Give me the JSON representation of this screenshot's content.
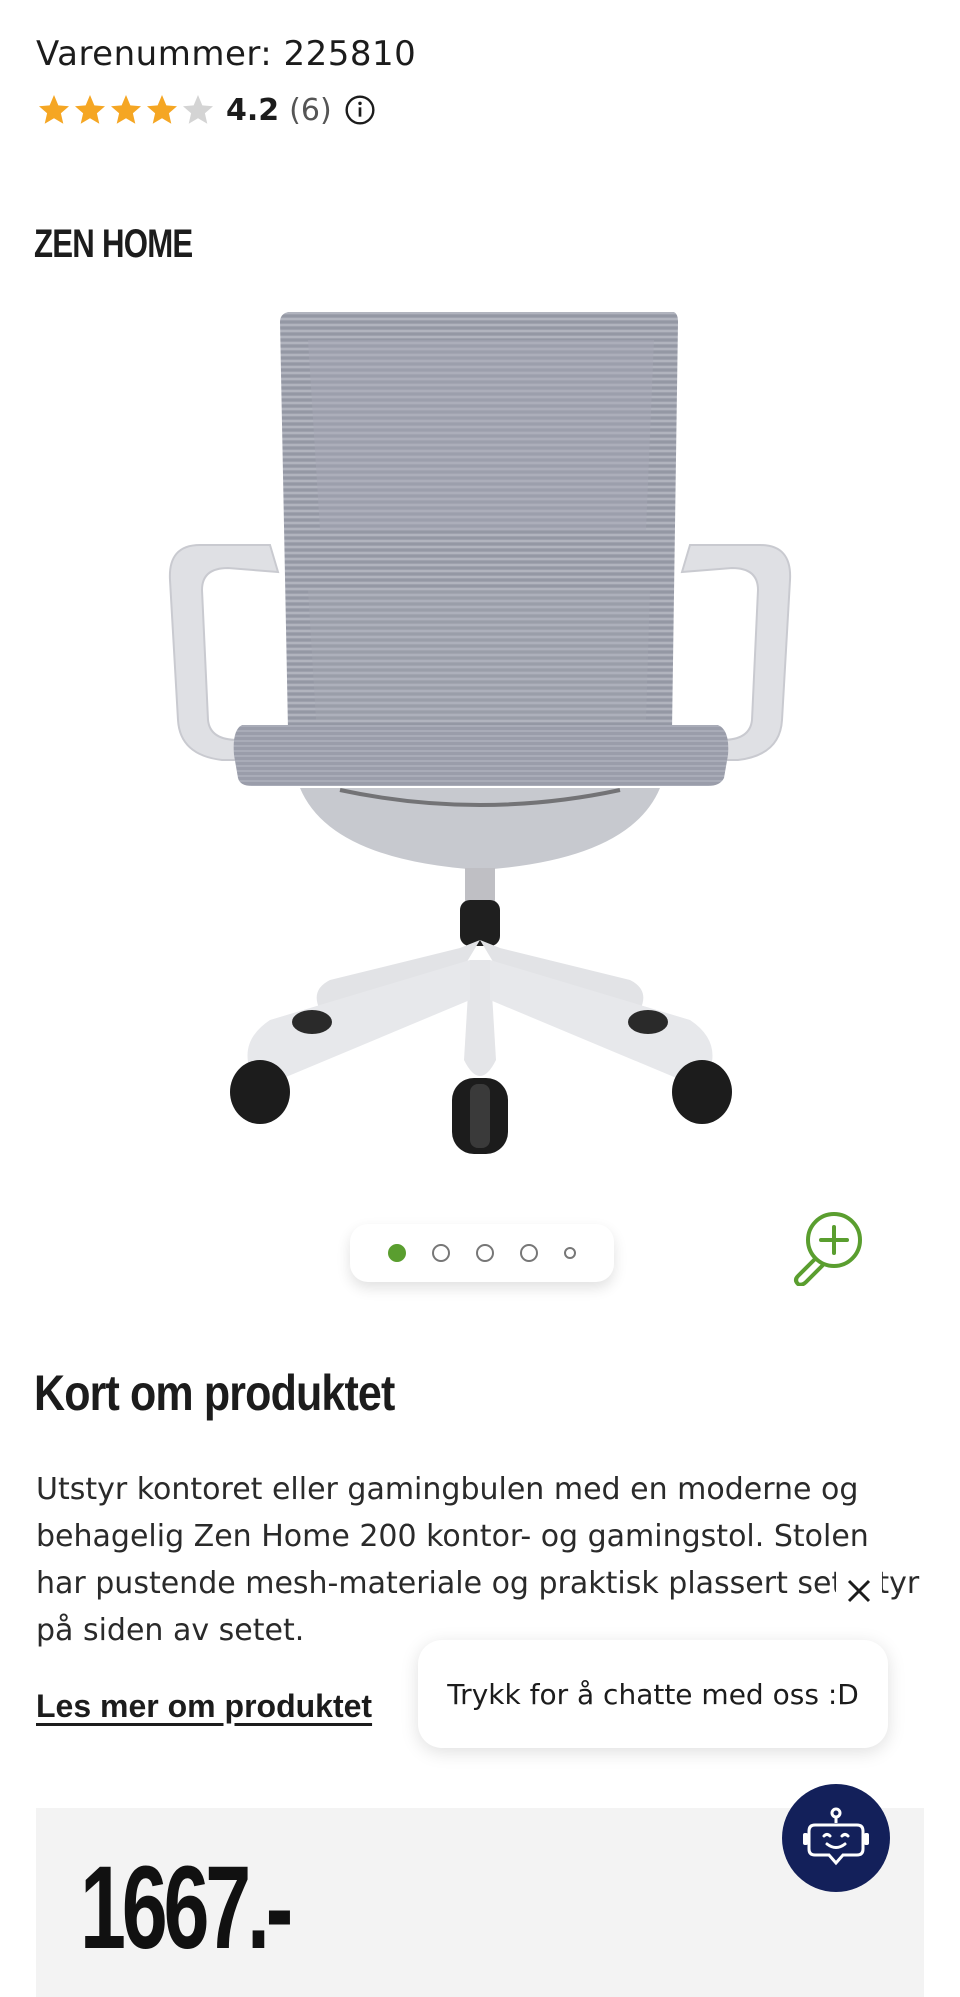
{
  "product": {
    "sku_label": "Varenummer: 225810",
    "rating_value": "4.2",
    "rating_count": "(6)",
    "rating_stars": 4.2,
    "brand": "ZEN HOME",
    "gallery": {
      "slides": 5,
      "active_index": 0
    }
  },
  "about": {
    "title": "Kort om produktet",
    "description": "Utstyr kontoret eller gamingbulen med en moderne og behagelig Zen Home 200 kontor- og gamingstol. Stolen har pustende mesh-materiale og praktisk plassert setestyr på siden av setet.",
    "read_more": "Les mer om produktet"
  },
  "chat": {
    "prompt": "Trykk for å chatte med oss :D"
  },
  "price": {
    "amount": "1667.-"
  },
  "colors": {
    "star": "#f5a623",
    "star_empty": "#cfcfcf",
    "accent_green": "#5a9e2f",
    "chat_fab": "#13205a"
  },
  "icons": [
    "star-icon",
    "info-icon",
    "zoom-in-icon",
    "close-icon",
    "chatbot-icon"
  ]
}
